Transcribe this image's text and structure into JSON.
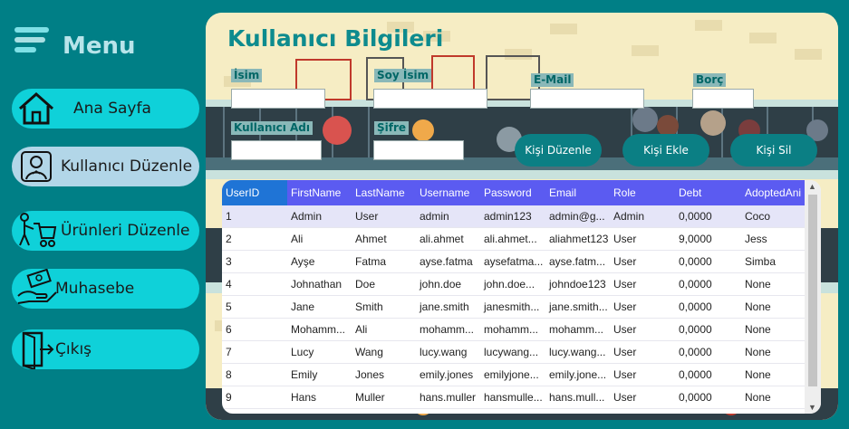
{
  "sidebar": {
    "title": "Menu",
    "items": [
      {
        "label": "Ana Sayfa",
        "icon": "home-icon"
      },
      {
        "label": "Kullanıcı Düzenle",
        "icon": "user-pet-icon"
      },
      {
        "label": "Ürünleri Düzenle",
        "icon": "shopping-cart-icon"
      },
      {
        "label": "Muhasebe",
        "icon": "money-hand-icon"
      },
      {
        "label": "Çıkış",
        "icon": "exit-door-icon"
      }
    ]
  },
  "form": {
    "title": "Kullanıcı Bilgileri",
    "fields": {
      "isim": {
        "label": "İsim",
        "value": ""
      },
      "soyisim": {
        "label": "Soy İsim",
        "value": ""
      },
      "email": {
        "label": "E-Mail",
        "value": ""
      },
      "borc": {
        "label": "Borç",
        "value": ""
      },
      "kullanici_adi": {
        "label": "Kullanıcı Adı",
        "value": ""
      },
      "sifre": {
        "label": "Şifre",
        "value": ""
      }
    },
    "buttons": {
      "edit": "Kişi Düzenle",
      "add": "Kişi Ekle",
      "delete": "Kişi Sil"
    }
  },
  "grid": {
    "columns": [
      "UserID",
      "FirstName",
      "LastName",
      "Username",
      "Password",
      "Email",
      "Role",
      "Debt",
      "AdoptedAni"
    ],
    "rows": [
      [
        "1",
        "Admin",
        "User",
        "admin",
        "admin123",
        "admin@g...",
        "Admin",
        "0,0000",
        "Coco"
      ],
      [
        "2",
        "Ali",
        "Ahmet",
        "ali.ahmet",
        "ali.ahmet...",
        "aliahmet123",
        "User",
        "9,0000",
        "Jess"
      ],
      [
        "3",
        "Ayşe",
        "Fatma",
        "ayse.fatma",
        "aysefatma...",
        "ayse.fatm...",
        "User",
        "0,0000",
        "Simba"
      ],
      [
        "4",
        "Johnathan",
        "Doe",
        "john.doe",
        "john.doe...",
        "johndoe123",
        "User",
        "0,0000",
        "None"
      ],
      [
        "5",
        "Jane",
        "Smith",
        "jane.smith",
        "janesmith...",
        "jane.smith...",
        "User",
        "0,0000",
        "None"
      ],
      [
        "6",
        "Mohamm...",
        "Ali",
        "mohamm...",
        "mohamm...",
        "mohamm...",
        "User",
        "0,0000",
        "None"
      ],
      [
        "7",
        "Lucy",
        "Wang",
        "lucy.wang",
        "lucywang...",
        "lucy.wang...",
        "User",
        "0,0000",
        "None"
      ],
      [
        "8",
        "Emily",
        "Jones",
        "emily.jones",
        "emilyjone...",
        "emily.jone...",
        "User",
        "0,0000",
        "None"
      ],
      [
        "9",
        "Hans",
        "Muller",
        "hans.muller",
        "hansmulle...",
        "hans.mull...",
        "User",
        "0,0000",
        "None"
      ]
    ]
  },
  "colors": {
    "background": "#007f86",
    "nav_button": "#0fd1d9",
    "nav_active": "#b2d6e8",
    "title": "#0e8b8e",
    "action_button": "#0b7f84",
    "grid_header": "#5b5bf1",
    "grid_header_selected": "#1f74d6"
  }
}
